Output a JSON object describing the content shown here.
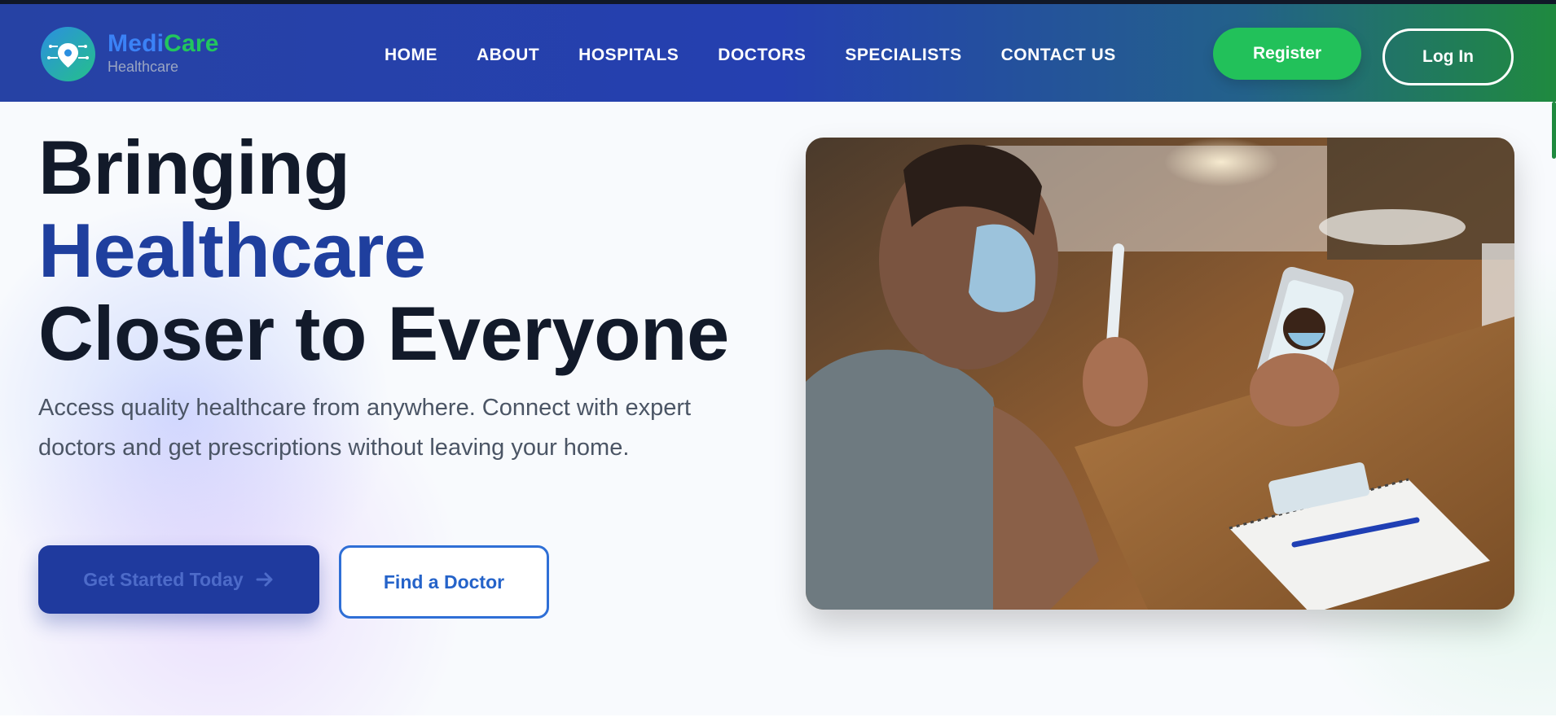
{
  "brand": {
    "name_part1": "Medi",
    "name_part2": "Care",
    "tagline": "Healthcare"
  },
  "nav": {
    "items": [
      "HOME",
      "ABOUT",
      "HOSPITALS",
      "DOCTORS",
      "SPECIALISTS",
      "CONTACT US"
    ],
    "register_label": "Register",
    "login_label": "Log In"
  },
  "hero": {
    "headline_line1": "Bringing",
    "headline_line2": "Healthcare",
    "headline_line3": "Closer to Everyone",
    "subtext": "Access quality healthcare from anywhere. Connect with expert doctors and get prescriptions without leaving your home.",
    "cta_primary": "Get Started Today",
    "cta_secondary": "Find a Doctor"
  },
  "colors": {
    "navy": "#1f3f9e",
    "green": "#22c15a",
    "dark_text": "#121a2a",
    "body_text": "#4b5565"
  },
  "icons": {
    "logo": "location-pin-icon",
    "cta_arrow": "arrow-right-icon"
  }
}
